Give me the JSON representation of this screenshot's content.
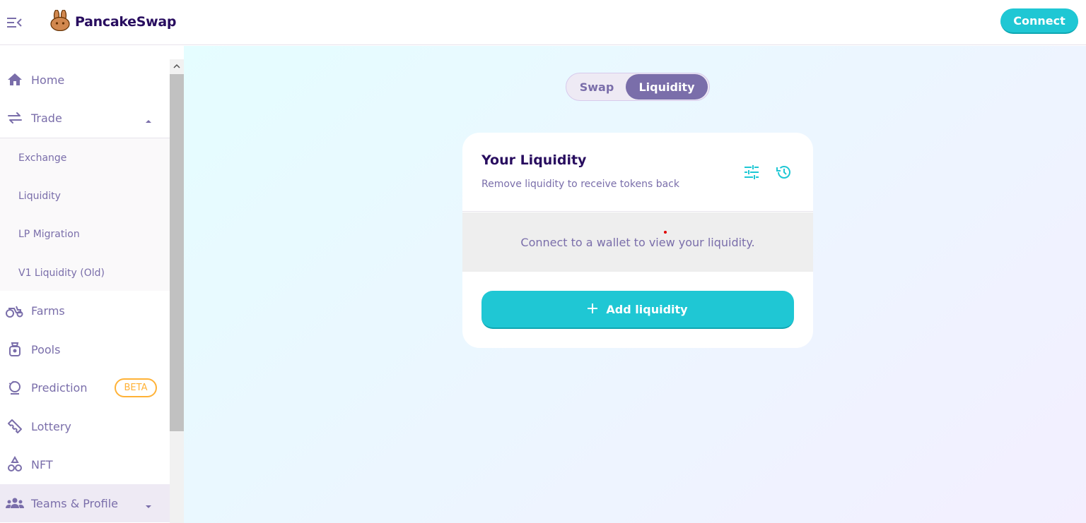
{
  "brand": {
    "name": "PancakeSwap",
    "accent": "#1fc7d4",
    "primary": "#7a6eaa",
    "text_dark": "#280d5f"
  },
  "topnav": {
    "connect_label": "Connect"
  },
  "sidebar": {
    "items": [
      {
        "label": "Home",
        "icon": "home-icon"
      },
      {
        "label": "Trade",
        "icon": "swap-arrows-icon",
        "expanded": true
      },
      {
        "label": "Farms",
        "icon": "tractor-icon"
      },
      {
        "label": "Pools",
        "icon": "pool-bag-icon"
      },
      {
        "label": "Prediction",
        "icon": "crystal-ball-icon",
        "badge": "BETA"
      },
      {
        "label": "Lottery",
        "icon": "ticket-icon"
      },
      {
        "label": "NFT",
        "icon": "shapes-icon"
      },
      {
        "label": "Teams & Profile",
        "icon": "team-icon"
      }
    ],
    "trade_submenu": [
      "Exchange",
      "Liquidity",
      "LP Migration",
      "V1 Liquidity (Old)"
    ]
  },
  "main": {
    "tabs": [
      {
        "label": "Swap",
        "active": false
      },
      {
        "label": "Liquidity",
        "active": true
      }
    ],
    "card": {
      "title": "Your Liquidity",
      "subtitle": "Remove liquidity to receive tokens back",
      "empty_message": "Connect to a wallet to view your liquidity.",
      "add_button_label": "Add liquidity"
    }
  }
}
